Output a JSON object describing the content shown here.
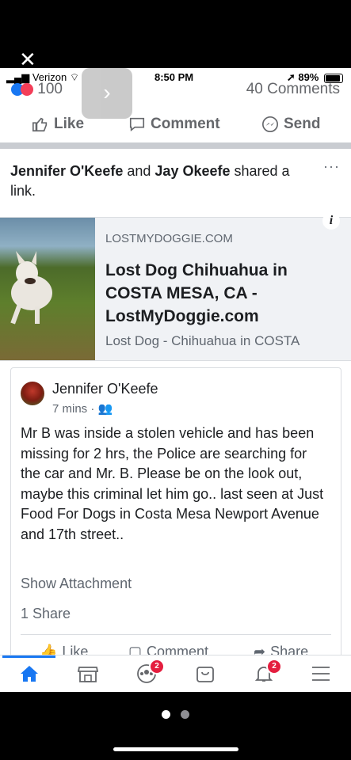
{
  "viewer": {
    "close_label": "✕"
  },
  "status_bar": {
    "carrier": "Verizon",
    "time": "8:50 PM",
    "battery": "89%"
  },
  "post_summary": {
    "reaction_count": "100",
    "comment_count": "40 Comments"
  },
  "actions": {
    "like": "Like",
    "comment": "Comment",
    "send": "Send"
  },
  "share_story": {
    "actor1": "Jennifer O'Keefe",
    "connector": "and",
    "actor2": "Jay Okeefe",
    "verb": "shared a link.",
    "more": "···"
  },
  "link_card": {
    "domain": "LOSTMYDOGGIE.COM",
    "title": "Lost Dog Chihuahua in COSTA MESA, CA - LostMyDoggie.com",
    "description": "Lost Dog - Chihuahua in COSTA",
    "info": "i"
  },
  "inner_post": {
    "author": "Jennifer O'Keefe",
    "time": "7 mins",
    "body": "Mr B was inside a stolen vehicle and has been missing for 2 hrs, the Police are searching for the car and Mr. B. Please be on the look out, maybe this criminal let him go.. last seen at Just Food For Dogs in Costa Mesa Newport Avenue and 17th street..",
    "show_attachment": "Show Attachment",
    "shares": "1 Share",
    "like": "Like",
    "comment": "Comment",
    "share": "Share"
  },
  "tab_bar": {
    "groups_badge": "2",
    "notifications_badge": "2"
  },
  "colors": {
    "brand": "#1877f2",
    "badge": "#e41e3f",
    "divider": "#c9ccd1"
  }
}
